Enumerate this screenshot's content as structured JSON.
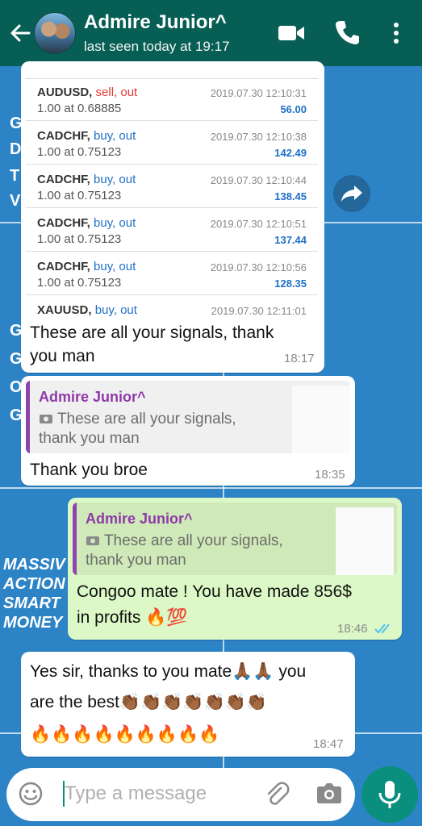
{
  "header": {
    "name": "Admire Junior^",
    "status": "last seen today at 19:17"
  },
  "wallpaper": {
    "letters_top": [
      "G",
      "D",
      "T",
      "V"
    ],
    "letters_mid": [
      "G",
      "G",
      "O",
      "G"
    ],
    "brand_lines": [
      "MASSIV",
      "ACTION",
      "SMART",
      "MONEY"
    ]
  },
  "trades": [
    {
      "symbol": "AUDUSD,",
      "direction": "sell, out",
      "dir_color": "#e53935",
      "lot": "1.00 at 0.68885",
      "datetime": "2019.07.30 12:10:31",
      "profit": "56.00"
    },
    {
      "symbol": "CADCHF,",
      "direction": "buy, out",
      "dir_color": "#1e6fc8",
      "lot": "1.00 at 0.75123",
      "datetime": "2019.07.30 12:10:38",
      "profit": "142.49"
    },
    {
      "symbol": "CADCHF,",
      "direction": "buy, out",
      "dir_color": "#1e6fc8",
      "lot": "1.00 at 0.75123",
      "datetime": "2019.07.30 12:10:44",
      "profit": "138.45"
    },
    {
      "symbol": "CADCHF,",
      "direction": "buy, out",
      "dir_color": "#1e6fc8",
      "lot": "1.00 at 0.75123",
      "datetime": "2019.07.30 12:10:51",
      "profit": "137.44"
    },
    {
      "symbol": "CADCHF,",
      "direction": "buy, out",
      "dir_color": "#1e6fc8",
      "lot": "1.00 at 0.75123",
      "datetime": "2019.07.30 12:10:56",
      "profit": "128.35"
    },
    {
      "symbol": "XAUUSD,",
      "direction": "buy, out",
      "dir_color": "#1e6fc8",
      "lot": "",
      "datetime": "2019.07.30 12:11:01",
      "profit": ""
    }
  ],
  "messages": {
    "m1": {
      "text_line1": "These are all your signals,  thank",
      "text_line2": "you man",
      "time": "18:17"
    },
    "m2": {
      "quote_name": "Admire Junior^",
      "quote_line1": "These are all your signals,",
      "quote_line2": "thank you man",
      "text": "Thank you broe",
      "time": "18:35"
    },
    "m3": {
      "quote_name": "Admire Junior^",
      "quote_line1": "These are all your signals,",
      "quote_line2": "thank you man",
      "text_line1": "Congoo mate ! You have made 856$",
      "text_line2": "in profits 🔥💯",
      "time": "18:46"
    },
    "m4": {
      "text_line1": "Yes sir, thanks to you mate🙏🏾🙏🏾 you",
      "text_line2": "are the best👏🏾👏🏾👏🏾👏🏾👏🏾👏🏾👏🏾",
      "text_line3": "🔥🔥🔥🔥🔥🔥🔥🔥🔥",
      "time": "18:47"
    }
  },
  "input": {
    "placeholder": "Type a message"
  },
  "icons": {
    "back": "back-arrow-icon",
    "video": "video-call-icon",
    "call": "phone-icon",
    "menu": "more-vert-icon",
    "forward": "forward-icon",
    "emoji": "emoji-icon",
    "attach": "paperclip-icon",
    "camera": "camera-icon",
    "mic": "mic-icon",
    "read": "double-check-icon",
    "photo": "photo-icon"
  },
  "colors": {
    "header": "#075e54",
    "accent": "#0a8f7f",
    "outgoing": "#dcf8c6",
    "read_ticks": "#4fc3f7",
    "quote_bar": "#8e44ad"
  }
}
